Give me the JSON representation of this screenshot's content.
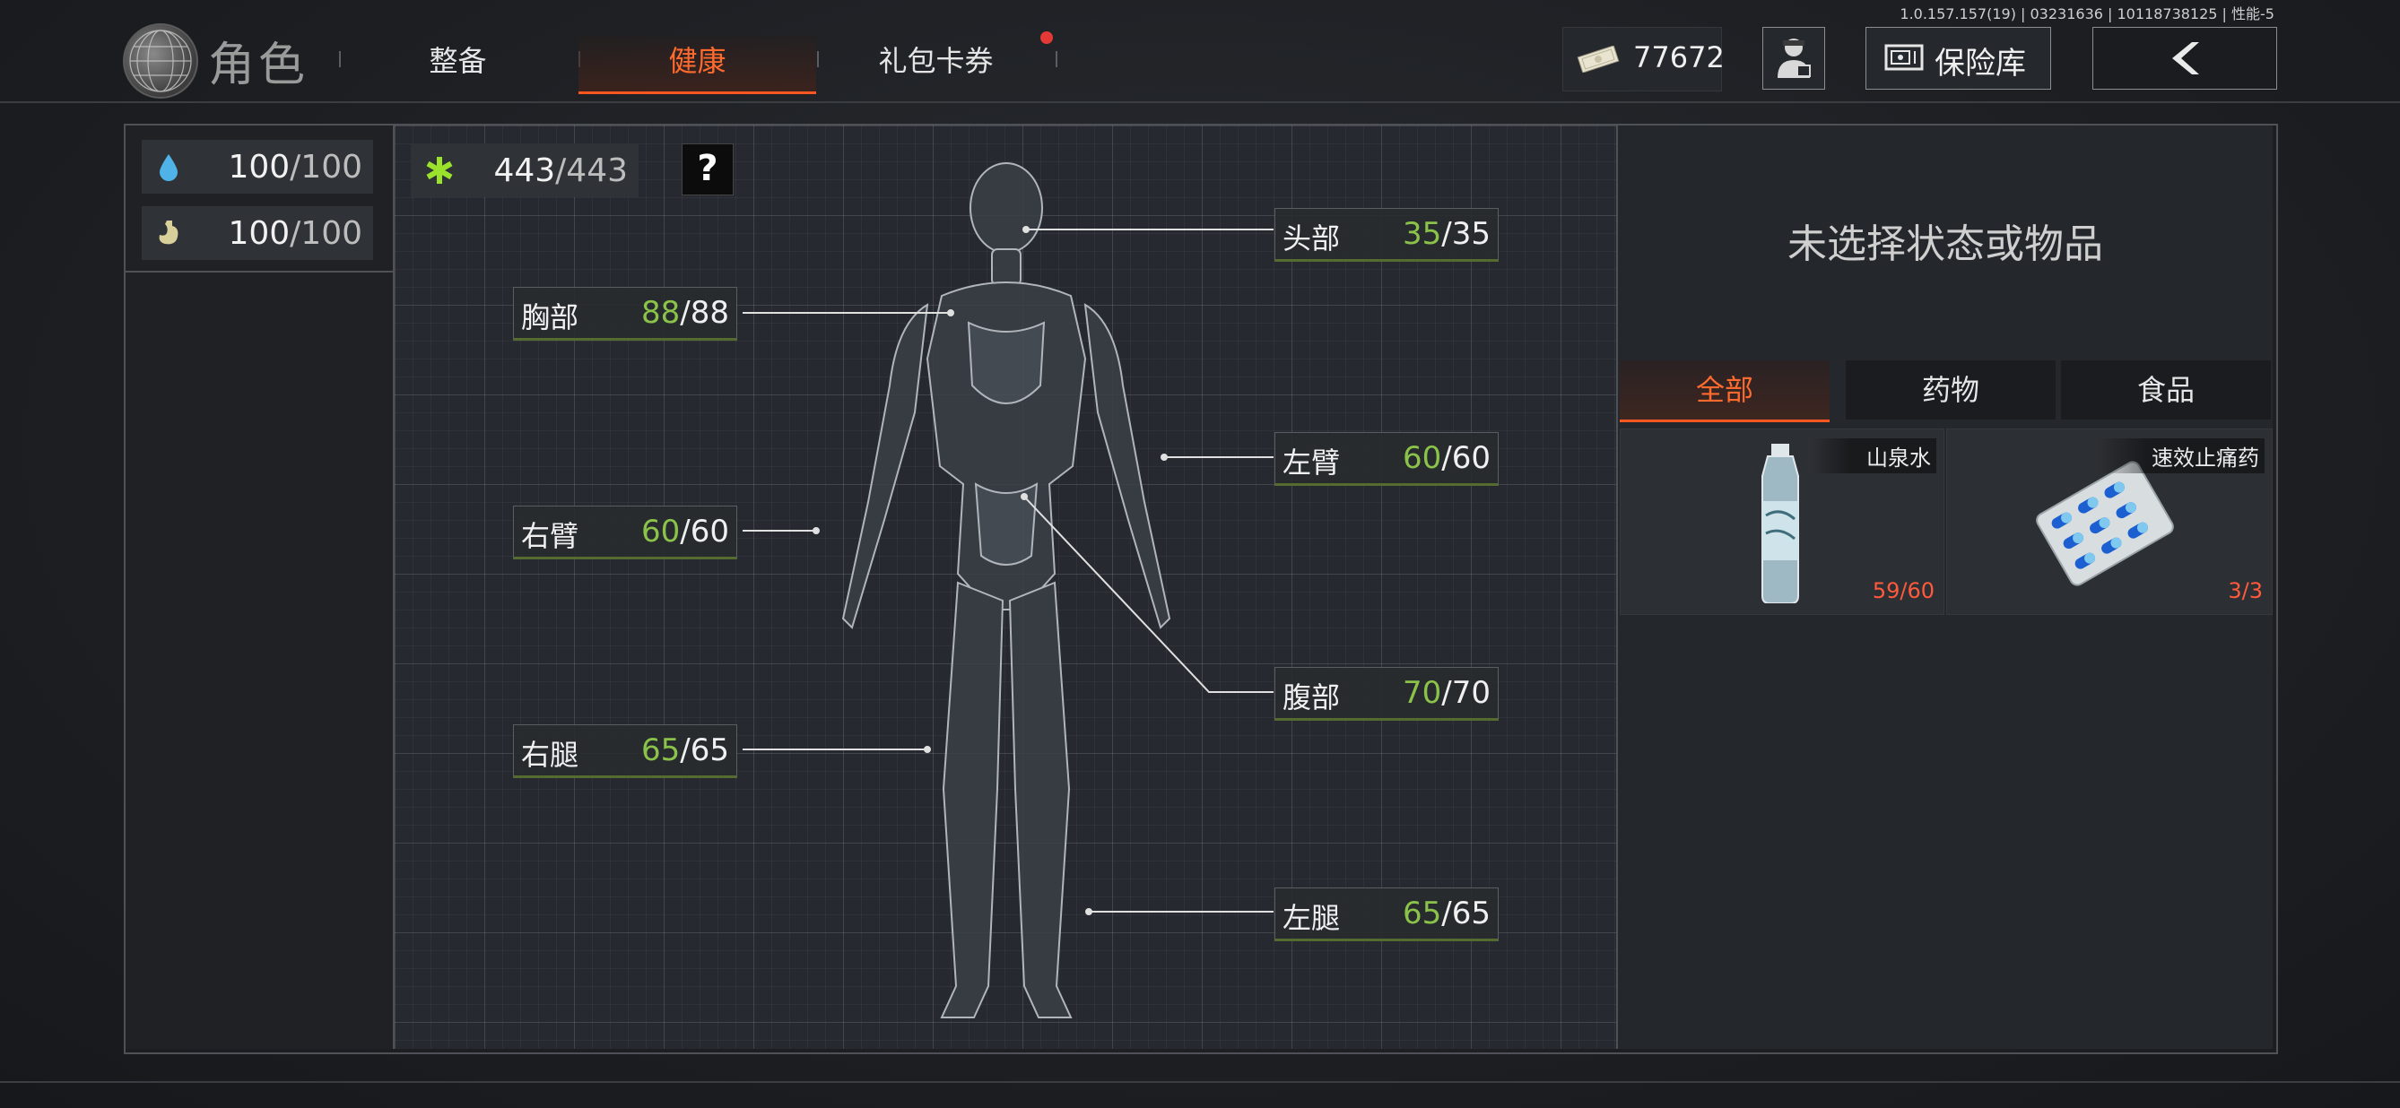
{
  "version": "1.0.157.157(19) | 03231636 | 10118738125 | 性能-5",
  "header": {
    "title": "角色",
    "tabs": [
      {
        "label": "整备",
        "active": false
      },
      {
        "label": "健康",
        "active": true
      },
      {
        "label": "礼包卡券",
        "active": false,
        "badge": true
      }
    ],
    "money": "77672",
    "vault_label": "保险库",
    "icons": [
      "currency-icon",
      "agent-icon",
      "vault-icon",
      "back-arrow-icon"
    ]
  },
  "vitals": {
    "hydration": {
      "current": "100",
      "max": "/100",
      "icon": "water-drop-icon"
    },
    "energy": {
      "current": "100",
      "max": "/100",
      "icon": "stomach-icon"
    }
  },
  "health_total": {
    "current": "443",
    "max": "/443",
    "icon": "medical-cross-icon"
  },
  "help_label": "?",
  "body_parts": {
    "head": {
      "name": "头部",
      "current": "35",
      "max": "/35"
    },
    "chest": {
      "name": "胸部",
      "current": "88",
      "max": "/88"
    },
    "left_arm": {
      "name": "左臂",
      "current": "60",
      "max": "/60"
    },
    "right_arm": {
      "name": "右臂",
      "current": "60",
      "max": "/60"
    },
    "abdomen": {
      "name": "腹部",
      "current": "70",
      "max": "/70"
    },
    "right_leg": {
      "name": "右腿",
      "current": "65",
      "max": "/65"
    },
    "left_leg": {
      "name": "左腿",
      "current": "65",
      "max": "/65"
    }
  },
  "right_panel": {
    "no_selection": "未选择状态或物品",
    "filter_tabs": [
      {
        "label": "全部",
        "active": true
      },
      {
        "label": "药物",
        "active": false
      },
      {
        "label": "食品",
        "active": false
      }
    ],
    "items": [
      {
        "name": "山泉水",
        "count": "59/60",
        "icon": "water-bottle-icon"
      },
      {
        "name": "速效止痛药",
        "count": "3/3",
        "icon": "pill-pack-icon"
      }
    ]
  },
  "colors": {
    "accent": "#ff5722",
    "health_green": "#8bc34a",
    "count_red": "#ff5a3c"
  }
}
